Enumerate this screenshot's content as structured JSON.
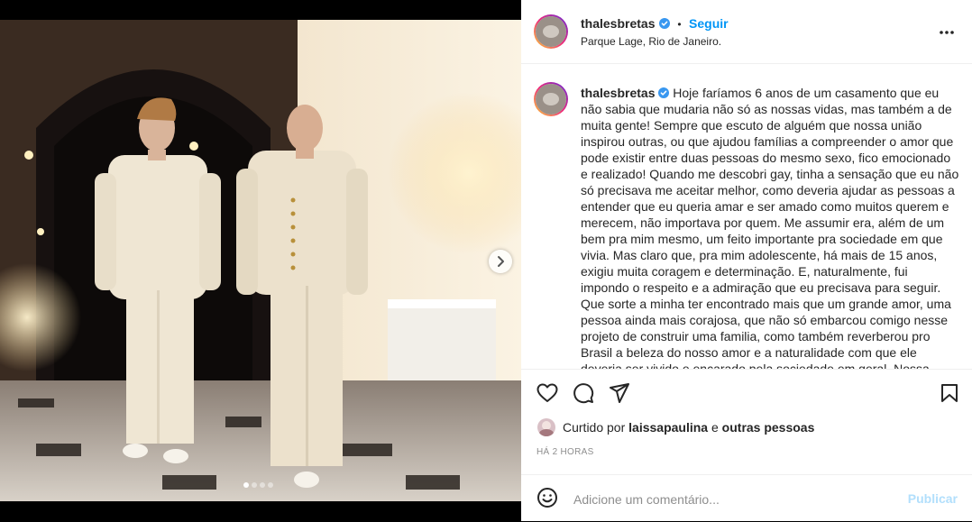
{
  "post": {
    "username": "thalesbretas",
    "follow_label": "Seguir",
    "separator": "•",
    "location": "Parque Lage, Rio de Janeiro.",
    "caption": "Hoje faríamos 6 anos de um casamento que eu não sabia que mudaria não só as nossas vidas, mas também a de muita gente! Sempre que escuto de alguém que nossa união inspirou outras, ou que ajudou famílias a compreender o amor que pode existir entre duas pessoas do mesmo sexo, fico emocionado e realizado! Quando me descobri gay, tinha a sensação que eu não só precisava me aceitar melhor, como deveria ajudar as pessoas a entender que eu queria amar e ser amado como muitos querem e merecem, não importava por quem. Me assumir era, além de um bem pra mim mesmo, um feito importante pra sociedade em que vivia. Mas claro que, pra mim adolescente, há mais de 15 anos, exigiu muita coragem e determinação. E, naturalmente, fui impondo o respeito e a admiração que eu precisava para seguir. Que sorte a minha ter encontrado mais que um grande amor, uma pessoa ainda mais corajosa, que não só embarcou comigo nesse projeto de construir uma familia, como também reverberou pro Brasil a beleza do nosso amor e a naturalidade com que ele deveria ser vivido e encarado pela sociedade em geral. Nossa família",
    "likes": {
      "prefix": "Curtido por",
      "user": "laissapaulina",
      "connector": "e",
      "others": "outras pessoas"
    },
    "time_ago": "HÁ 2 HORAS",
    "carousel": {
      "count": 4,
      "active_index": 0
    }
  },
  "comment": {
    "placeholder": "Adicione um comentário...",
    "publish_label": "Publicar"
  },
  "icons": {
    "more": "more-options-icon",
    "like": "heart-icon",
    "comment": "comment-icon",
    "share": "share-icon",
    "save": "bookmark-icon",
    "emoji": "emoji-icon",
    "next": "chevron-right-icon",
    "verified": "verified-badge-icon"
  },
  "colors": {
    "accent": "#0095f6",
    "publish_disabled": "#b2dffc",
    "verified": "#3897f0",
    "muted": "#8e8e8e"
  }
}
